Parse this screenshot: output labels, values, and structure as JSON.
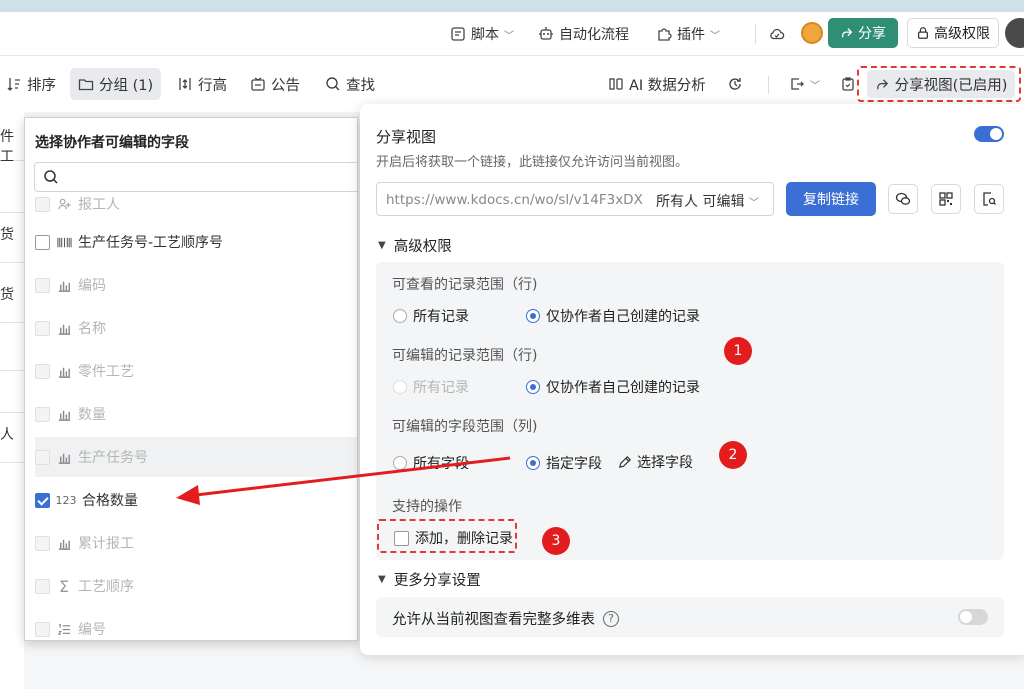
{
  "topbar": {
    "items": [
      {
        "label": "脚本",
        "icon": "script-icon"
      },
      {
        "label": "自动化流程",
        "icon": "robot-icon"
      },
      {
        "label": "插件",
        "icon": "puzzle-icon"
      }
    ],
    "share_label": "分享",
    "perm_label": "高级权限"
  },
  "toolbar": {
    "sort": "排序",
    "group": "分组 (1)",
    "row_height": "行高",
    "notice": "公告",
    "find": "查找",
    "ai_label": "AI 数据分析",
    "share_view": "分享视图(已启用)"
  },
  "grid_chars": [
    "件工",
    "货",
    "货",
    "人"
  ],
  "field_panel": {
    "title": "选择协作者可编辑的字段",
    "search_placeholder": "",
    "fields": [
      {
        "label": "报工人",
        "icon": "user-add-icon",
        "checked": false,
        "disabled": true
      },
      {
        "label": "生产任务号-工艺顺序号",
        "icon": "barcode-icon",
        "checked": false,
        "disabled": false
      },
      {
        "label": "编码",
        "icon": "bar-chart-icon",
        "checked": false,
        "disabled": true
      },
      {
        "label": "名称",
        "icon": "bar-chart-icon",
        "checked": false,
        "disabled": true
      },
      {
        "label": "零件工艺",
        "icon": "bar-chart-icon",
        "checked": false,
        "disabled": true
      },
      {
        "label": "数量",
        "icon": "bar-chart-icon",
        "checked": false,
        "disabled": true
      },
      {
        "label": "生产任务号",
        "icon": "bar-chart-icon",
        "checked": false,
        "disabled": true
      },
      {
        "label": "合格数量",
        "icon": "number-icon",
        "checked": true,
        "disabled": false
      },
      {
        "label": "累计报工",
        "icon": "bar-chart-icon",
        "checked": false,
        "disabled": true
      },
      {
        "label": "工艺顺序",
        "icon": "sigma-icon",
        "checked": false,
        "disabled": true
      },
      {
        "label": "编号",
        "icon": "numbered-list-icon",
        "checked": false,
        "disabled": true
      }
    ],
    "number_icon_text": "123",
    "sigma_text": "Σ"
  },
  "share_panel": {
    "title": "分享视图",
    "subtitle": "开启后将获取一个链接，此链接仅允许访问当前视图。",
    "link_url": "https://www.kdocs.cn/wo/sl/v14F3xDX",
    "link_perm": "所有人 可编辑",
    "copy_label": "复制链接",
    "adv_title": "高级权限",
    "view_range_label": "可查看的记录范围（行)",
    "edit_range_label": "可编辑的记录范围（行)",
    "field_range_label": "可编辑的字段范围（列)",
    "ops_label": "支持的操作",
    "all_records": "所有记录",
    "own_records": "仅协作者自己创建的记录",
    "all_fields": "所有字段",
    "specified_fields": "指定字段",
    "pick_fields": "选择字段",
    "add_delete": "添加，删除记录",
    "more_title": "更多分享设置",
    "full_table": "允许从当前视图查看完整多维表",
    "help_text": "?"
  },
  "badges": [
    "1",
    "2",
    "3"
  ],
  "colors": {
    "accent": "#3b6fd6",
    "share_green": "#2f8f74",
    "annotation_red": "#e31d1d"
  }
}
